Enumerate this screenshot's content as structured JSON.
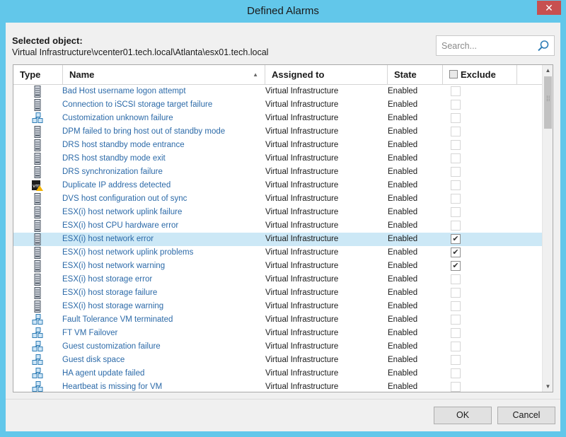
{
  "window": {
    "title": "Defined Alarms",
    "close_glyph": "✕"
  },
  "selected": {
    "label": "Selected object:",
    "path": "Virtual Infrastructure\\vcenter01.tech.local\\Atlanta\\esx01.tech.local"
  },
  "search": {
    "placeholder": "Search...",
    "icon": "magnifier-icon"
  },
  "table": {
    "columns": [
      "Type",
      "Name",
      "Assigned to",
      "State",
      "Exclude"
    ],
    "sort": {
      "column": "Name",
      "direction": "ascending"
    },
    "rows": [
      {
        "type": "host",
        "name": "Bad Host username logon attempt",
        "assigned": "Virtual Infrastructure",
        "state": "Enabled",
        "exclude": false
      },
      {
        "type": "host",
        "name": "Connection to iSCSI storage target failure",
        "assigned": "Virtual Infrastructure",
        "state": "Enabled",
        "exclude": false
      },
      {
        "type": "vm",
        "name": "Customization unknown failure",
        "assigned": "Virtual Infrastructure",
        "state": "Enabled",
        "exclude": false
      },
      {
        "type": "host",
        "name": "DPM failed to bring host out of standby mode",
        "assigned": "Virtual Infrastructure",
        "state": "Enabled",
        "exclude": false
      },
      {
        "type": "host",
        "name": "DRS host standby mode entrance",
        "assigned": "Virtual Infrastructure",
        "state": "Enabled",
        "exclude": false
      },
      {
        "type": "host",
        "name": "DRS host standby mode exit",
        "assigned": "Virtual Infrastructure",
        "state": "Enabled",
        "exclude": false
      },
      {
        "type": "host",
        "name": "DRS synchronization failure",
        "assigned": "Virtual Infrastructure",
        "state": "Enabled",
        "exclude": false
      },
      {
        "type": "vm-warning",
        "name": "Duplicate IP address detected",
        "assigned": "Virtual Infrastructure",
        "state": "Enabled",
        "exclude": false
      },
      {
        "type": "host",
        "name": "DVS host configuration out of sync",
        "assigned": "Virtual Infrastructure",
        "state": "Enabled",
        "exclude": false
      },
      {
        "type": "host",
        "name": "ESX(i) host network uplink failure",
        "assigned": "Virtual Infrastructure",
        "state": "Enabled",
        "exclude": false
      },
      {
        "type": "host",
        "name": "ESX(i) host CPU hardware error",
        "assigned": "Virtual Infrastructure",
        "state": "Enabled",
        "exclude": false
      },
      {
        "type": "host",
        "name": "ESX(i) host network error",
        "assigned": "Virtual Infrastructure",
        "state": "Enabled",
        "exclude": true,
        "selected": true
      },
      {
        "type": "host",
        "name": "ESX(i) host network uplink problems",
        "assigned": "Virtual Infrastructure",
        "state": "Enabled",
        "exclude": true
      },
      {
        "type": "host",
        "name": "ESX(i) host network warning",
        "assigned": "Virtual Infrastructure",
        "state": "Enabled",
        "exclude": true
      },
      {
        "type": "host",
        "name": "ESX(i) host storage error",
        "assigned": "Virtual Infrastructure",
        "state": "Enabled",
        "exclude": false
      },
      {
        "type": "host",
        "name": "ESX(i) host storage failure",
        "assigned": "Virtual Infrastructure",
        "state": "Enabled",
        "exclude": false
      },
      {
        "type": "host",
        "name": "ESX(i) host storage warning",
        "assigned": "Virtual Infrastructure",
        "state": "Enabled",
        "exclude": false
      },
      {
        "type": "vm",
        "name": "Fault Tolerance VM terminated",
        "assigned": "Virtual Infrastructure",
        "state": "Enabled",
        "exclude": false
      },
      {
        "type": "vm",
        "name": "FT VM Failover",
        "assigned": "Virtual Infrastructure",
        "state": "Enabled",
        "exclude": false
      },
      {
        "type": "vm",
        "name": "Guest customization failure",
        "assigned": "Virtual Infrastructure",
        "state": "Enabled",
        "exclude": false
      },
      {
        "type": "vm",
        "name": "Guest disk space",
        "assigned": "Virtual Infrastructure",
        "state": "Enabled",
        "exclude": false
      },
      {
        "type": "vm",
        "name": "HA agent update failed",
        "assigned": "Virtual Infrastructure",
        "state": "Enabled",
        "exclude": false
      },
      {
        "type": "vm",
        "name": "Heartbeat is missing for VM",
        "assigned": "Virtual Infrastructure",
        "state": "Enabled",
        "exclude": false
      }
    ]
  },
  "buttons": {
    "ok": "OK",
    "cancel": "Cancel"
  },
  "check_glyph": "✔",
  "colors": {
    "titlebar": "#62c7ea",
    "close": "#c75050",
    "link": "#2c6aa8",
    "selection": "#cce8f6"
  }
}
